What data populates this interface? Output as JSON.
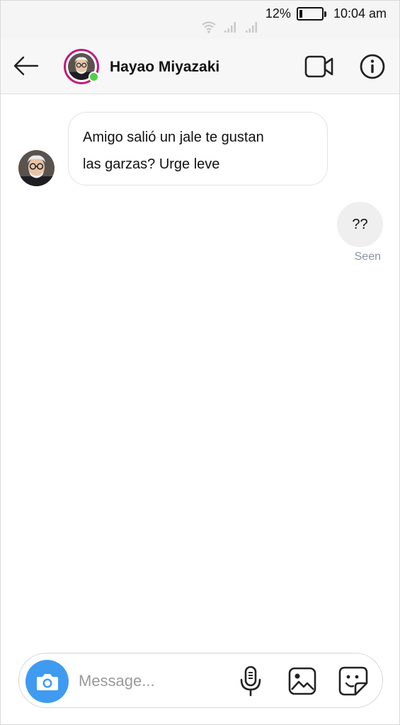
{
  "status_bar": {
    "battery_percent_label": "12%",
    "battery_level": 0.12,
    "time": "10:04 am"
  },
  "header": {
    "contact_name": "Hayao Miyazaki",
    "online": true,
    "ring_color": "#c21a80",
    "online_color": "#4fd14a"
  },
  "messages": [
    {
      "direction": "incoming",
      "text_line1": "Amigo salió un jale te gustan",
      "text_line2": "las garzas? Urge leve"
    },
    {
      "direction": "outgoing",
      "text": "??"
    }
  ],
  "seen_label": "Seen",
  "composer": {
    "placeholder": "Message...",
    "value": "",
    "camera_color": "#3f9bf0"
  },
  "icons": [
    "back-arrow-icon",
    "video-call-icon",
    "info-icon",
    "camera-icon",
    "microphone-icon",
    "gallery-icon",
    "sticker-icon",
    "wifi-icon",
    "signal-icon",
    "battery-icon"
  ]
}
